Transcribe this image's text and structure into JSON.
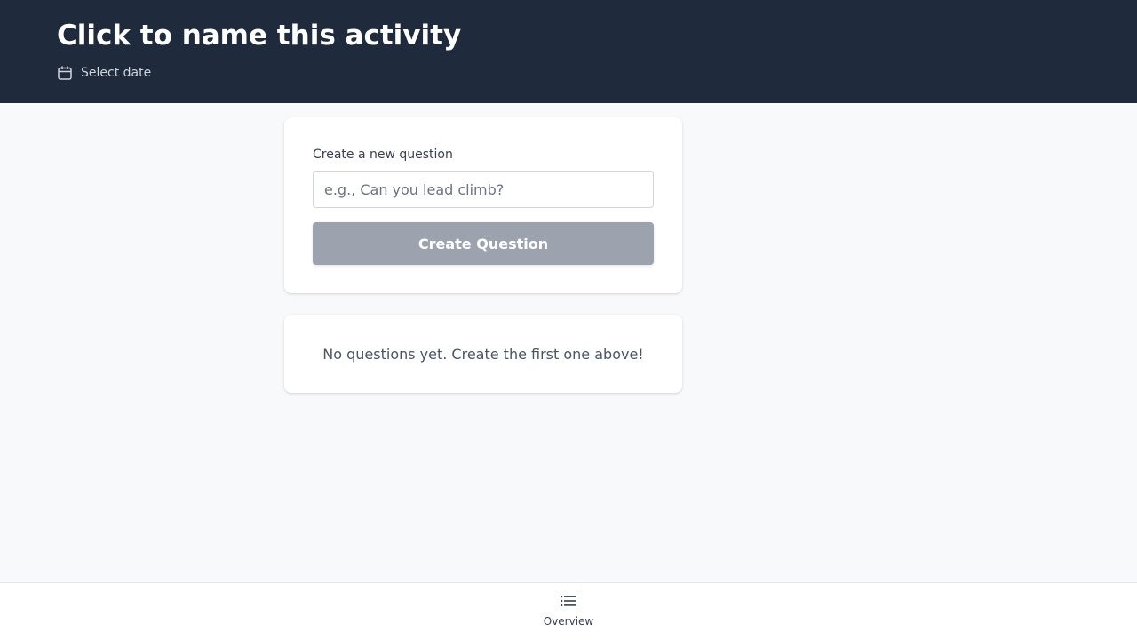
{
  "header": {
    "title": "Click to name this activity",
    "date_label": "Select date",
    "calendar_icon": "calendar-icon"
  },
  "create_card": {
    "label": "Create a new question",
    "input_value": "",
    "input_placeholder": "e.g., Can you lead climb?",
    "button_label": "Create Question"
  },
  "empty_state": {
    "message": "No questions yet. Create the first one above!"
  },
  "bottom_nav": {
    "items": [
      {
        "label": "Overview",
        "icon": "list-icon"
      }
    ]
  },
  "colors": {
    "header_bg": "#1f2a3c",
    "page_bg": "#f8f9fb",
    "button_disabled_bg": "#9ca3af"
  }
}
